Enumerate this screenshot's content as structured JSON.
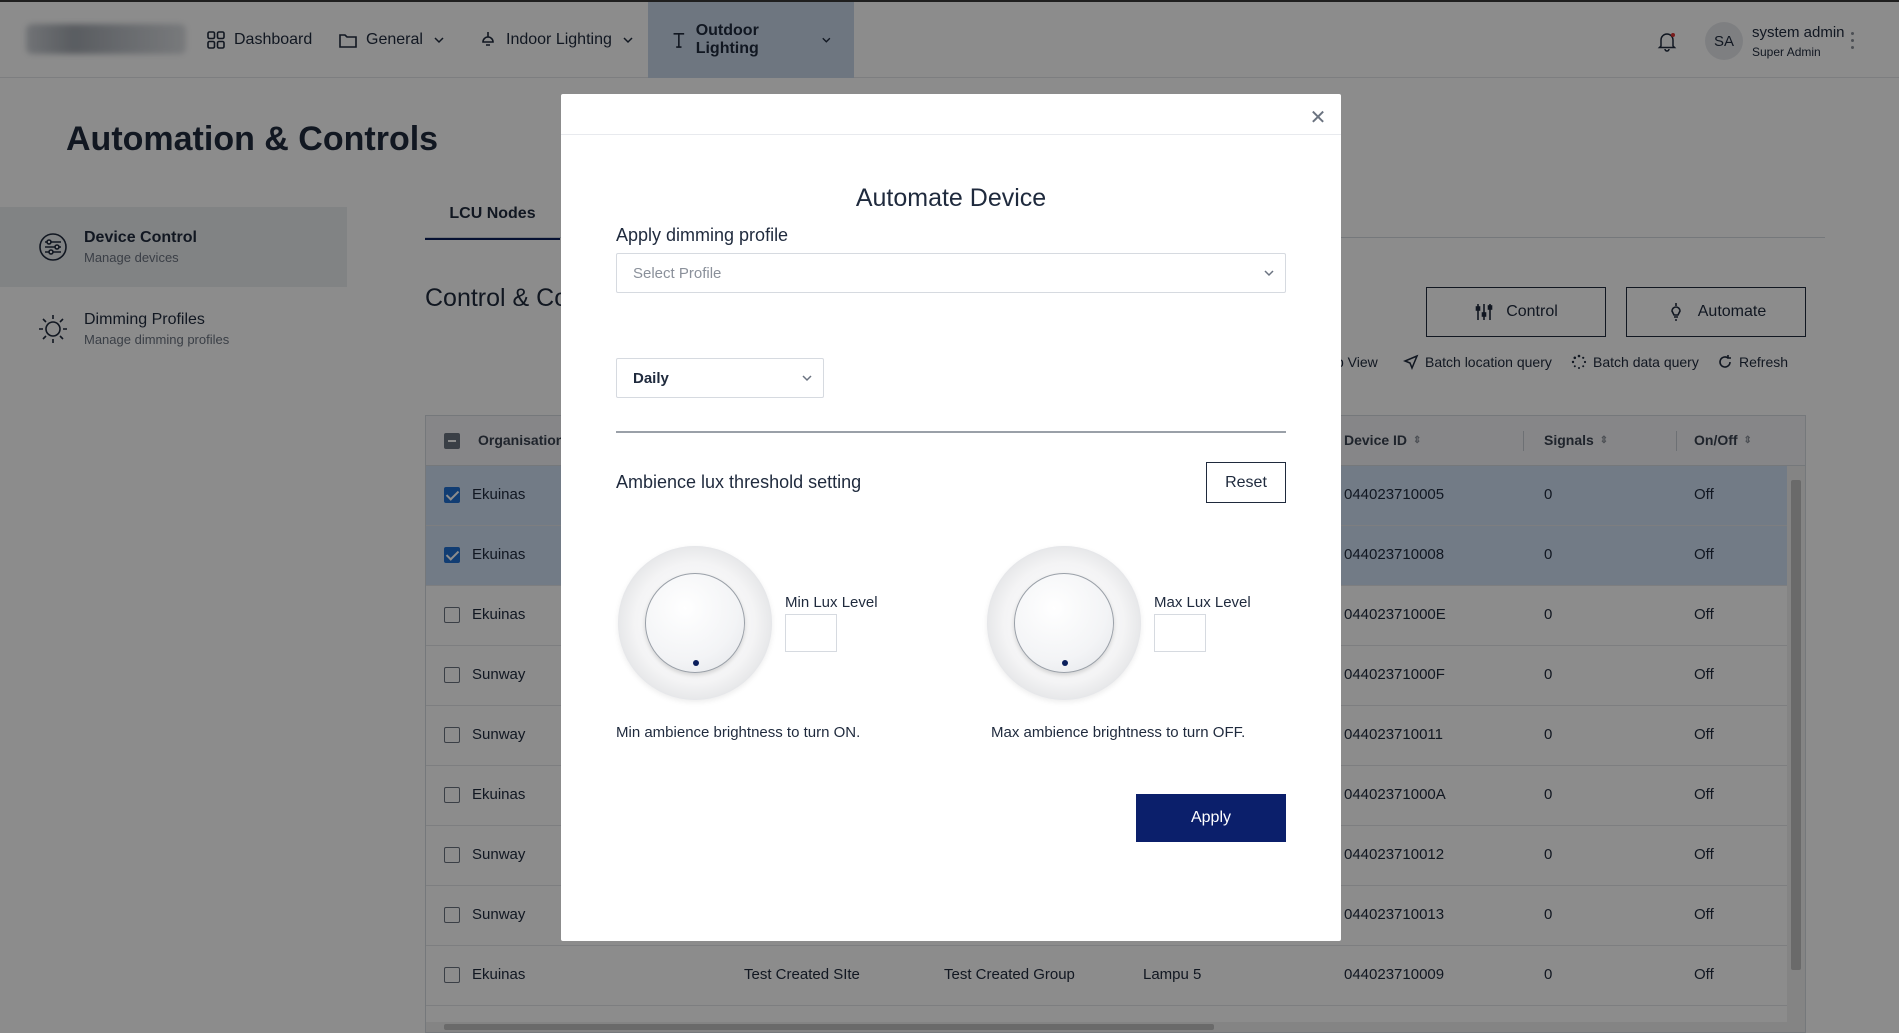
{
  "nav": {
    "dashboard": "Dashboard",
    "general": "General",
    "indoor": "Indoor Lighting",
    "outdoor": "Outdoor Lighting"
  },
  "user": {
    "initials": "SA",
    "name": "system admin",
    "role": "Super Admin"
  },
  "page": {
    "title": "Automation & Controls",
    "section_title": "Control & Co"
  },
  "sidebar": {
    "items": [
      {
        "title": "Device Control",
        "subtitle": "Manage devices"
      },
      {
        "title": "Dimming Profiles",
        "subtitle": "Manage dimming profiles"
      }
    ]
  },
  "tabs": {
    "lcu": "LCU Nodes"
  },
  "actions": {
    "control": "Control",
    "automate": "Automate"
  },
  "toolbar": {
    "map_view": "p View",
    "batch_location": "Batch location query",
    "batch_data": "Batch data query",
    "refresh": "Refresh"
  },
  "table": {
    "headers": {
      "organisation": "Organisation",
      "device_id": "Device ID",
      "signals": "Signals",
      "onoff": "On/Off"
    },
    "rows": [
      {
        "checked": true,
        "org": "Ekuinas",
        "site": "",
        "group": "",
        "name": "",
        "device_id": "044023710005",
        "signals": "0",
        "onoff": "Off"
      },
      {
        "checked": true,
        "org": "Ekuinas",
        "site": "",
        "group": "",
        "name": "",
        "device_id": "044023710008",
        "signals": "0",
        "onoff": "Off"
      },
      {
        "checked": false,
        "org": "Ekuinas",
        "site": "",
        "group": "",
        "name": "",
        "device_id": "04402371000E",
        "signals": "0",
        "onoff": "Off"
      },
      {
        "checked": false,
        "org": "Sunway",
        "site": "",
        "group": "",
        "name": "",
        "device_id": "04402371000F",
        "signals": "0",
        "onoff": "Off"
      },
      {
        "checked": false,
        "org": "Sunway",
        "site": "",
        "group": "",
        "name": "",
        "device_id": "044023710011",
        "signals": "0",
        "onoff": "Off"
      },
      {
        "checked": false,
        "org": "Ekuinas",
        "site": "",
        "group": "",
        "name": "",
        "device_id": "04402371000A",
        "signals": "0",
        "onoff": "Off"
      },
      {
        "checked": false,
        "org": "Sunway",
        "site": "",
        "group": "",
        "name": "",
        "device_id": "044023710012",
        "signals": "0",
        "onoff": "Off"
      },
      {
        "checked": false,
        "org": "Sunway",
        "site": "",
        "group": "",
        "name": "",
        "device_id": "044023710013",
        "signals": "0",
        "onoff": "Off"
      },
      {
        "checked": false,
        "org": "Ekuinas",
        "site": "Test Created SIte",
        "group": "Test Created Group",
        "name": "Lampu 5",
        "device_id": "044023710009",
        "signals": "0",
        "onoff": "Off"
      }
    ]
  },
  "modal": {
    "title": "Automate Device",
    "dimming_label": "Apply dimming profile",
    "profile_placeholder": "Select Profile",
    "schedule_value": "Daily",
    "ambience_label": "Ambience lux threshold setting",
    "reset": "Reset",
    "min_label": "Min Lux Level",
    "max_label": "Max Lux Level",
    "min_desc": "Min ambience brightness to turn ON.",
    "max_desc": "Max ambience brightness to turn OFF.",
    "apply": "Apply"
  },
  "colors": {
    "primary": "#0b1f6b",
    "selected_row": "#cfe0f5",
    "active_nav": "#c8d7ea"
  }
}
